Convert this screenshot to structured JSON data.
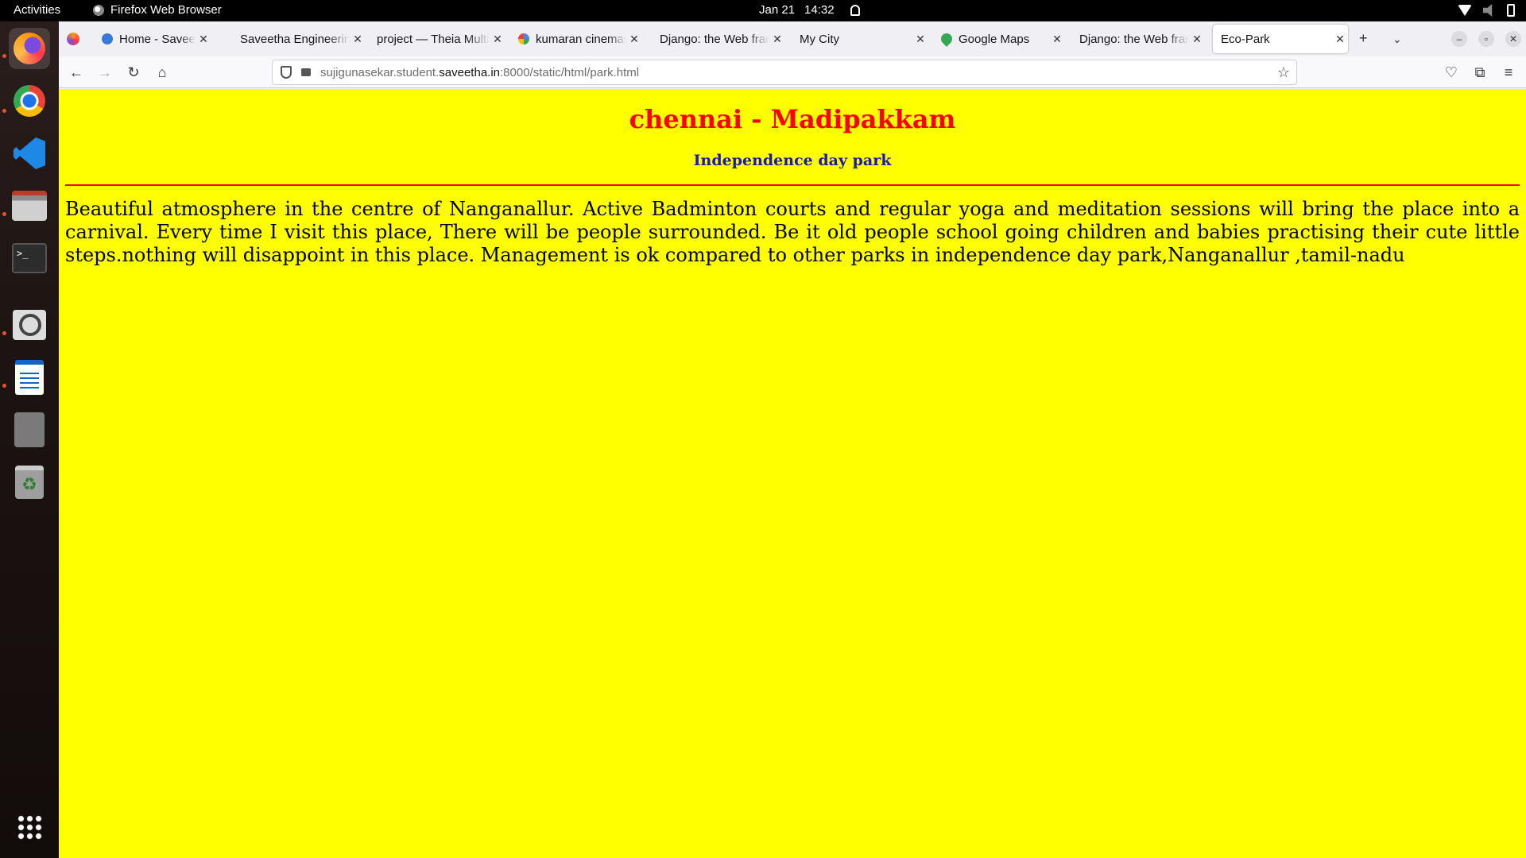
{
  "topbar": {
    "activities": "Activities",
    "app_name": "Firefox Web Browser",
    "date": "Jan 21",
    "time": "14:32"
  },
  "dock": {
    "items": [
      "firefox-icon",
      "chrome-icon",
      "vscode-icon",
      "files-icon",
      "terminal-icon",
      "image-viewer-icon",
      "writer-icon",
      "ssd-icon",
      "trash-icon",
      "app-grid-icon"
    ],
    "running_color": "#e95420"
  },
  "browser": {
    "tabs": [
      {
        "label": "Home - Saveetha (",
        "active": false
      },
      {
        "label": "Saveetha Engineering",
        "active": false
      },
      {
        "label": "project — Theia Multi",
        "active": false
      },
      {
        "label": "kumaran cinemas",
        "active": false
      },
      {
        "label": "Django: the Web fram",
        "active": false
      },
      {
        "label": "My City",
        "active": false
      },
      {
        "label": "Google Maps",
        "active": false
      },
      {
        "label": "Django: the Web fram",
        "active": false
      },
      {
        "label": "Eco-Park",
        "active": true
      }
    ],
    "url_prefix": "sujigunasekar.student.",
    "url_domain": "saveetha.in",
    "url_suffix": ":8000/static/html/park.html"
  },
  "page": {
    "background": "#ffff00",
    "heading": "chennai - Madipakkam",
    "heading_color": "#ff0000",
    "subheading": "Independence day park",
    "subheading_color": "#1a1ab3",
    "paragraph": "Beautiful atmosphere in the centre of Nanganallur. Active Badminton courts and regular yoga and meditation sessions will bring the place into a carnival. Every time I visit this place, There will be people surrounded. Be it old people school going children and babies practising their cute little steps.nothing will disappoint in this place. Management is ok compared to other parks in independence day park,Nanganallur ,tamil-nadu"
  }
}
